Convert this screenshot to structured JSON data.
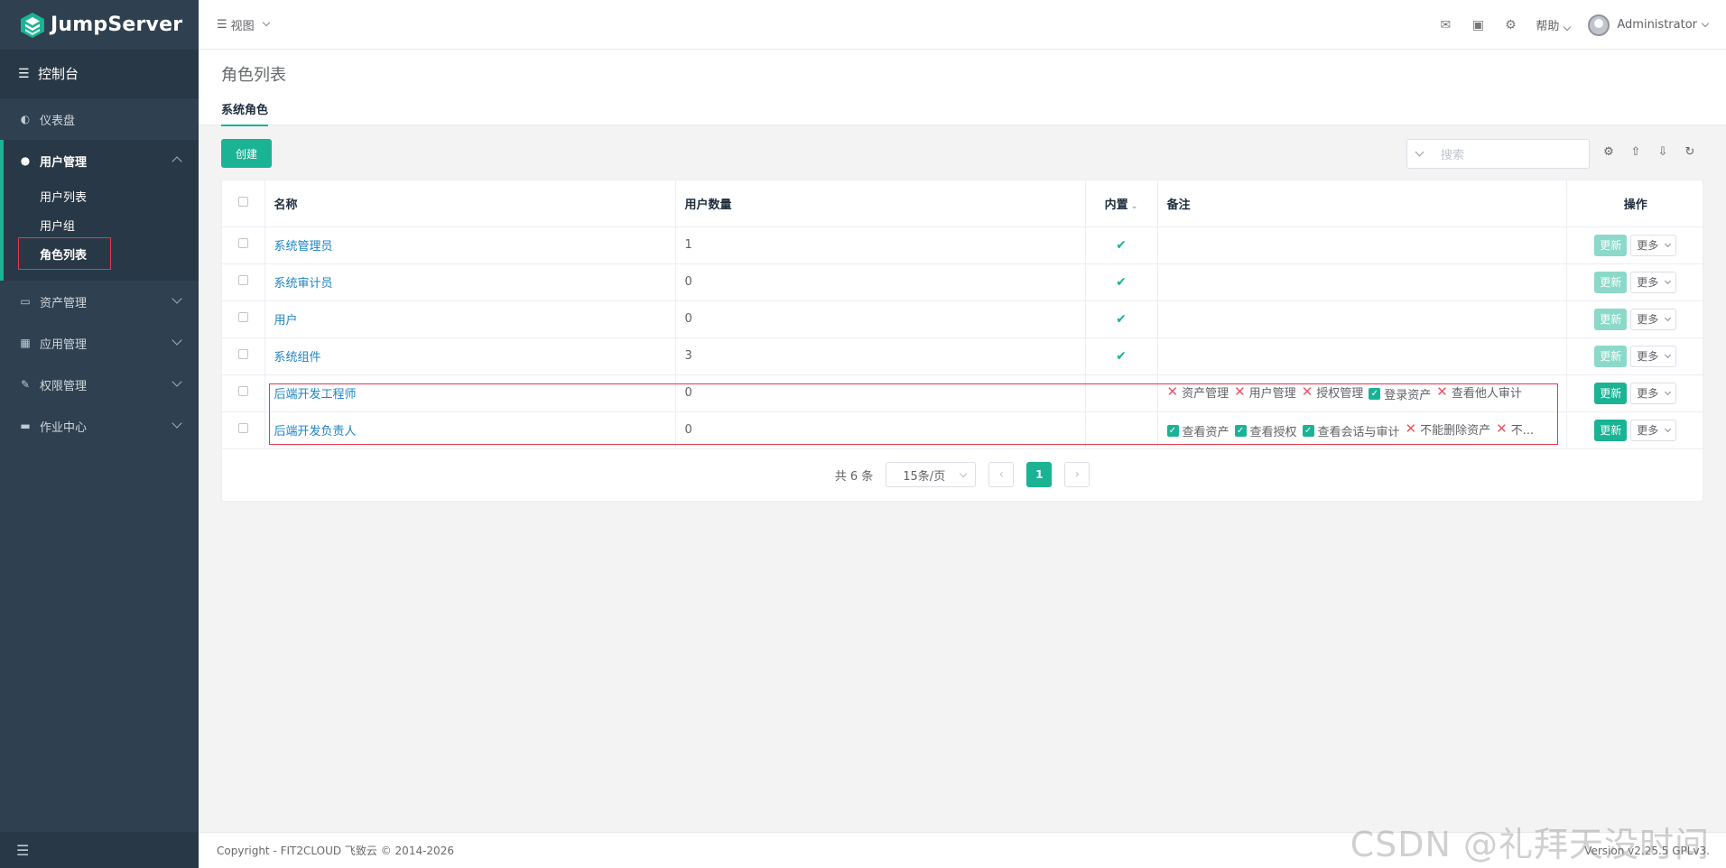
{
  "app": {
    "name": "JumpServer"
  },
  "sidebar": {
    "console_label": "控制台",
    "items": [
      {
        "label": "仪表盘",
        "icon": "dashboard-icon"
      },
      {
        "label": "用户管理",
        "icon": "users-icon",
        "expanded": true,
        "children": [
          "用户列表",
          "用户组",
          "角色列表"
        ],
        "active_child": "角色列表"
      },
      {
        "label": "资产管理",
        "icon": "hdd-icon"
      },
      {
        "label": "应用管理",
        "icon": "grid-icon"
      },
      {
        "label": "权限管理",
        "icon": "edit-icon"
      },
      {
        "label": "作业中心",
        "icon": "keyboard-icon"
      }
    ],
    "collapse_icon": "menu-fold-icon"
  },
  "header": {
    "view_label": "视图",
    "help_label": "帮助",
    "user_name": "Administrator"
  },
  "page": {
    "title": "角色列表",
    "tab": "系统角色",
    "create_label": "创建",
    "search_placeholder": "搜索"
  },
  "table": {
    "columns": [
      "名称",
      "用户数量",
      "内置",
      "备注",
      "操作"
    ],
    "update_label": "更新",
    "more_label": "更多",
    "rows": [
      {
        "name": "系统管理员",
        "count": "1",
        "builtin": true,
        "perms": []
      },
      {
        "name": "系统审计员",
        "count": "0",
        "builtin": true,
        "perms": []
      },
      {
        "name": "用户",
        "count": "0",
        "builtin": true,
        "perms": []
      },
      {
        "name": "系统组件",
        "count": "3",
        "builtin": true,
        "perms": []
      },
      {
        "name": "后端开发工程师",
        "count": "0",
        "builtin": false,
        "perms": [
          {
            "ok": false,
            "text": "资产管理"
          },
          {
            "ok": false,
            "text": "用户管理"
          },
          {
            "ok": false,
            "text": "授权管理"
          },
          {
            "ok": true,
            "text": "登录资产"
          },
          {
            "ok": false,
            "text": "查看他人审计"
          }
        ]
      },
      {
        "name": "后端开发负责人",
        "count": "0",
        "builtin": false,
        "perms": [
          {
            "ok": true,
            "text": "查看资产"
          },
          {
            "ok": true,
            "text": "查看授权"
          },
          {
            "ok": true,
            "text": "查看会话与审计"
          },
          {
            "ok": false,
            "text": "不能删除资产"
          },
          {
            "ok": false,
            "text": "不..."
          }
        ]
      }
    ]
  },
  "pagination": {
    "total_label": "共 6 条",
    "page_size_label": "15条/页",
    "current_page": "1"
  },
  "footer": {
    "copyright": "Copyright - FIT2CLOUD 飞致云 © 2014-2026",
    "version": "Version v2.25.5 GPLv3."
  },
  "watermark": "CSDN @礼拜天没时间",
  "colors": {
    "accent": "#1ab394",
    "sidebar": "#2f4050",
    "link": "#1c84c6",
    "danger": "#ed5565",
    "highlight_box": "#e8374c"
  }
}
